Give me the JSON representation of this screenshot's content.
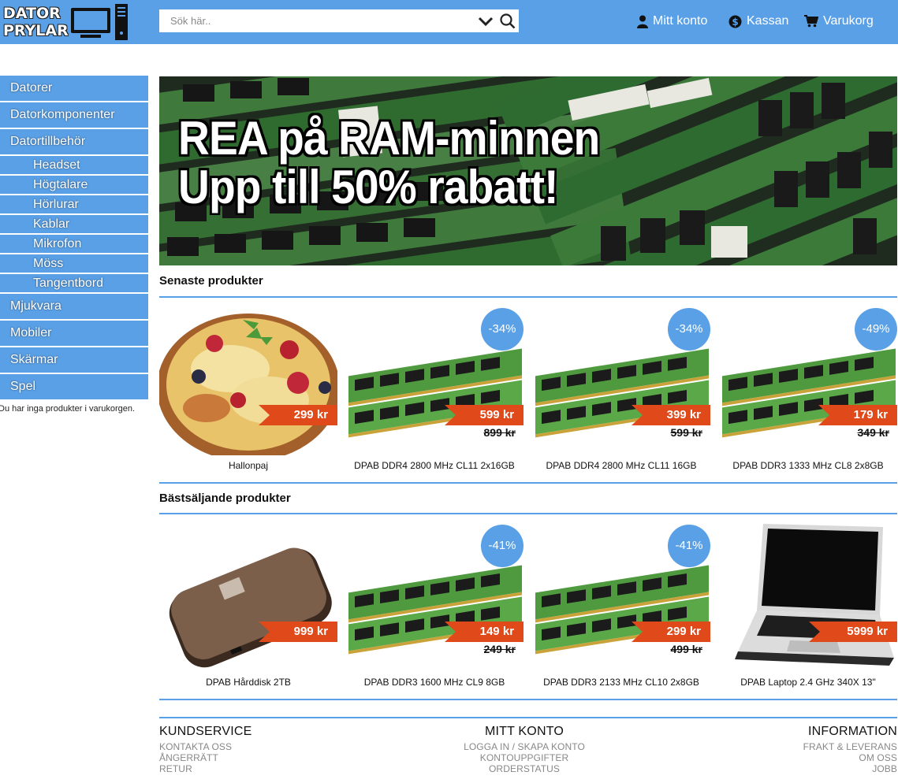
{
  "header": {
    "logo_line1": "DATOR",
    "logo_line2": "PRYLAR",
    "search_placeholder": "Sök här..",
    "links": {
      "account": "Mitt konto",
      "checkout": "Kassan",
      "cart": "Varukorg"
    }
  },
  "sidebar": {
    "categories": [
      {
        "label": "Datorer"
      },
      {
        "label": "Datorkomponenter"
      },
      {
        "label": "Datortillbehör"
      }
    ],
    "subcategories": [
      {
        "label": "Headset"
      },
      {
        "label": "Högtalare"
      },
      {
        "label": "Hörlurar"
      },
      {
        "label": "Kablar"
      },
      {
        "label": "Mikrofon"
      },
      {
        "label": "Möss"
      },
      {
        "label": "Tangentbord"
      }
    ],
    "categories_after": [
      {
        "label": "Mjukvara"
      },
      {
        "label": "Mobiler"
      },
      {
        "label": "Skärmar"
      },
      {
        "label": "Spel"
      }
    ],
    "cart_empty_text": "Du har inga produkter i varukorgen."
  },
  "banner": {
    "line1": "REA på RAM-minnen",
    "line2": "Upp till 50% rabatt!"
  },
  "latest": {
    "title": "Senaste produkter",
    "products": [
      {
        "name": "Hallonpaj",
        "price": "299 kr",
        "old_price": "",
        "discount": "",
        "image": "pie"
      },
      {
        "name": "DPAB DDR4 2800 MHz CL11 2x16GB",
        "price": "599 kr",
        "old_price": "899 kr",
        "discount": "-34%",
        "image": "ram"
      },
      {
        "name": "DPAB DDR4 2800 MHz CL11 16GB",
        "price": "399 kr",
        "old_price": "599 kr",
        "discount": "-34%",
        "image": "ram"
      },
      {
        "name": "DPAB DDR3 1333 MHz CL8 2x8GB",
        "price": "179 kr",
        "old_price": "349 kr",
        "discount": "-49%",
        "image": "ram"
      }
    ]
  },
  "bestsellers": {
    "title": "Bästsäljande produkter",
    "products": [
      {
        "name": "DPAB Hårddisk 2TB",
        "price": "999 kr",
        "old_price": "",
        "discount": "",
        "image": "hdd"
      },
      {
        "name": "DPAB DDR3 1600 MHz CL9 8GB",
        "price": "149 kr",
        "old_price": "249 kr",
        "discount": "-41%",
        "image": "ram"
      },
      {
        "name": "DPAB DDR3 2133 MHz CL10 2x8GB",
        "price": "299 kr",
        "old_price": "499 kr",
        "discount": "-41%",
        "image": "ram"
      },
      {
        "name": "DPAB Laptop 2.4 GHz 340X 13\"",
        "price": "5999 kr",
        "old_price": "",
        "discount": "",
        "image": "laptop"
      }
    ]
  },
  "footer": {
    "customer_service": {
      "title": "KUNDSERVICE",
      "links": [
        "KONTAKTA OSS",
        "ÅNGERRÄTT",
        "RETUR"
      ]
    },
    "my_account": {
      "title": "MITT KONTO",
      "links": [
        "LOGGA IN / SKAPA KONTO",
        "KONTOUPPGIFTER",
        "ORDERSTATUS"
      ]
    },
    "information": {
      "title": "INFORMATION",
      "links": [
        "FRAKT & LEVERANS",
        "OM OSS",
        "JOBB"
      ]
    }
  },
  "colors": {
    "accent": "#5aa0e6",
    "price_tag": "#e04a1a"
  }
}
